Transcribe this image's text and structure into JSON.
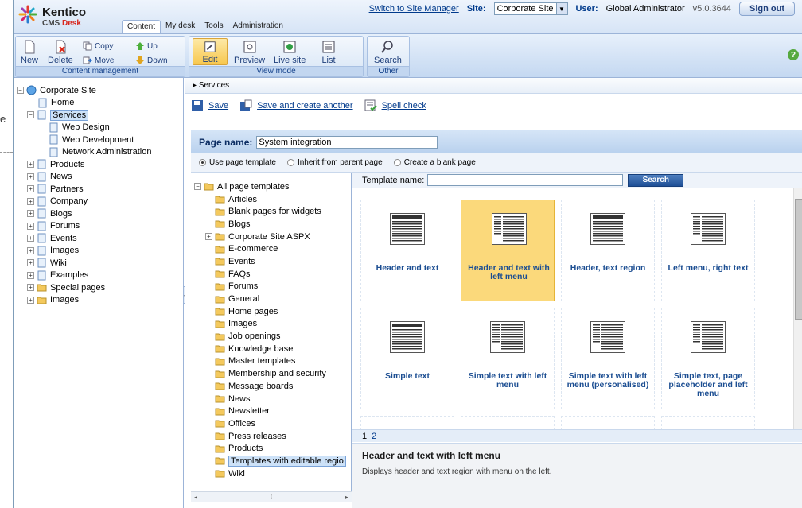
{
  "background_text": "e",
  "header": {
    "logo_name": "Kentico",
    "logo_cms": "CMS",
    "logo_desk": "Desk",
    "switch_link": "Switch to Site Manager",
    "site_label": "Site:",
    "site_value": "Corporate Site",
    "user_label": "User:",
    "user_value": "Global Administrator",
    "version": "v5.0.3644",
    "signout": "Sign out",
    "tabs": [
      "Content",
      "My desk",
      "Tools",
      "Administration"
    ]
  },
  "ribbon": {
    "content_management": {
      "caption": "Content management",
      "new": "New",
      "delete": "Delete",
      "copy": "Copy",
      "move": "Move",
      "up": "Up",
      "down": "Down"
    },
    "view_mode": {
      "caption": "View mode",
      "edit": "Edit",
      "preview": "Preview",
      "live_site": "Live site",
      "list": "List"
    },
    "other": {
      "caption": "Other",
      "search": "Search"
    },
    "help": "?"
  },
  "tree": {
    "root": "Corporate Site",
    "items": [
      "Home",
      "Services",
      "Web Design",
      "Web Development",
      "Network Administration",
      "Products",
      "News",
      "Partners",
      "Company",
      "Blogs",
      "Forums",
      "Events",
      "Images",
      "Wiki",
      "Examples",
      "Special pages",
      "Images"
    ]
  },
  "main": {
    "breadcrumb": "Services",
    "save": "Save",
    "save_another": "Save and create another",
    "spell_check": "Spell check",
    "page_name_label": "Page name:",
    "page_name_value": "System integration",
    "radio_options": [
      "Use page template",
      "Inherit from parent page",
      "Create a blank page"
    ],
    "categories_root": "All page templates",
    "categories": [
      "Articles",
      "Blank pages for widgets",
      "Blogs",
      "Corporate Site ASPX",
      "E-commerce",
      "Events",
      "FAQs",
      "Forums",
      "General",
      "Home pages",
      "Images",
      "Job openings",
      "Knowledge base",
      "Master templates",
      "Membership and security",
      "Message boards",
      "News",
      "Newsletter",
      "Offices",
      "Press releases",
      "Products",
      "Templates with editable regio",
      "Wiki"
    ],
    "template_name_label": "Template name:",
    "search_button": "Search",
    "templates": [
      "Header and text",
      "Header and text with left menu",
      "Header, text region",
      "Left menu, right text",
      "Simple text",
      "Simple text with left menu",
      "Simple text with left menu (personalised)",
      "Simple text, page placeholder and left menu"
    ],
    "pager": [
      "1",
      "2"
    ],
    "selected_title": "Header and text with left menu",
    "selected_desc": "Displays header and text region with menu on the left."
  },
  "colors": {
    "accent": "#1c4e92",
    "selected_tile": "#fbd97b",
    "ribbon": "#c4d8f1"
  }
}
